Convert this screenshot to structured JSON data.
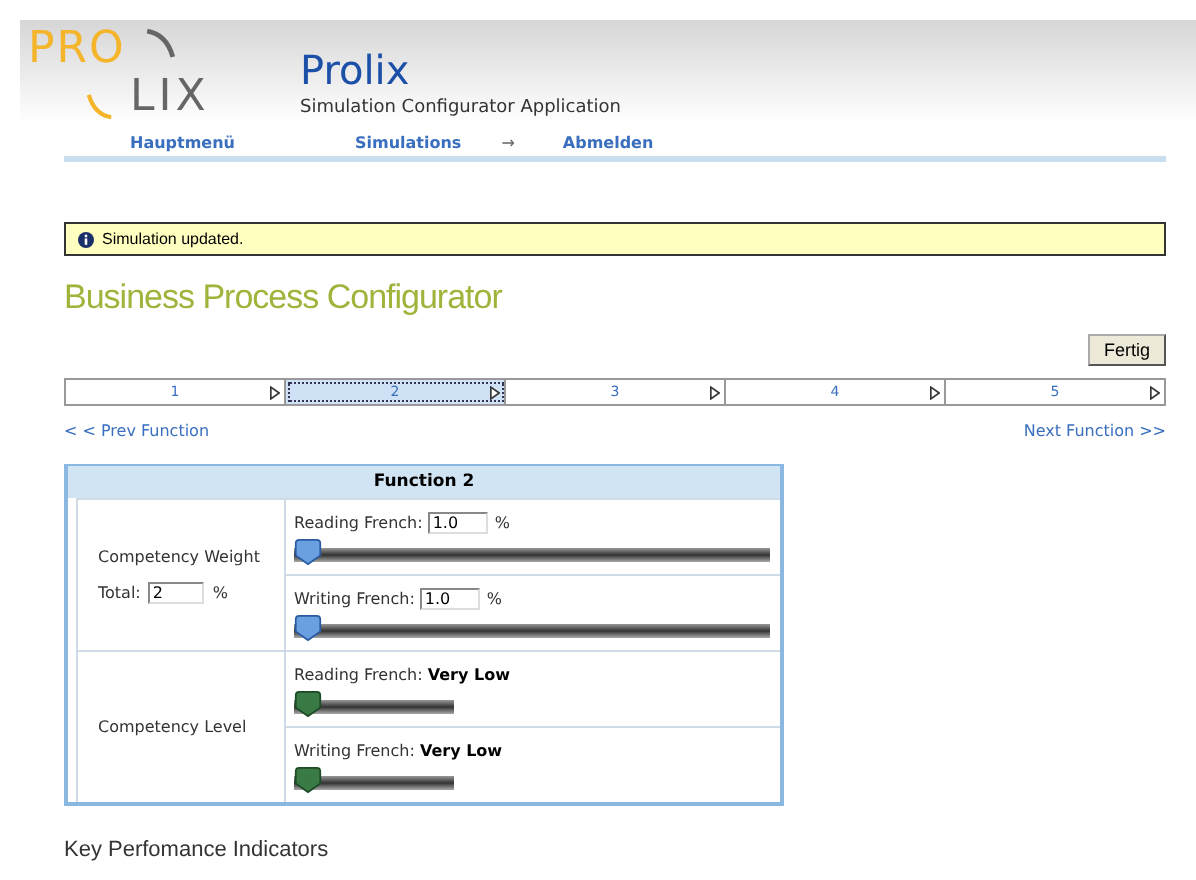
{
  "header": {
    "logo_top": "PRO",
    "logo_bottom": "LIX",
    "title": "Prolix",
    "subtitle": "Simulation Configurator Application"
  },
  "nav": [
    {
      "label": "Hauptmenü",
      "kind": "link"
    },
    {
      "label": "Simulations",
      "kind": "link"
    },
    {
      "label": "→",
      "kind": "arrow"
    },
    {
      "label": "Abmelden",
      "kind": "link"
    }
  ],
  "notice": "Simulation updated.",
  "page_title": "Business Process Configurator",
  "done_button": "Fertig",
  "steps": [
    {
      "label": "1",
      "selected": false
    },
    {
      "label": "2",
      "selected": true
    },
    {
      "label": "3",
      "selected": false
    },
    {
      "label": "4",
      "selected": false
    },
    {
      "label": "5",
      "selected": false
    }
  ],
  "prev_link": "< < Prev Function",
  "next_link": "Next Function >>",
  "function_panel": {
    "title": "Function 2",
    "weight": {
      "label": "Competency Weight",
      "total_label": "Total:",
      "total_value": "2",
      "total_unit": "%",
      "sliders": [
        {
          "label": "Reading French:",
          "value": "1.0",
          "unit": "%",
          "level": 0
        },
        {
          "label": "Writing French:",
          "value": "1.0",
          "unit": "%",
          "level": 0
        }
      ]
    },
    "competency_level": {
      "label": "Competency Level",
      "sliders": [
        {
          "label": "Reading French:",
          "value": "Very Low",
          "level": 0
        },
        {
          "label": "Writing French:",
          "value": "Very Low",
          "level": 0
        }
      ]
    }
  },
  "kpi_heading": "Key Perfomance Indicators"
}
